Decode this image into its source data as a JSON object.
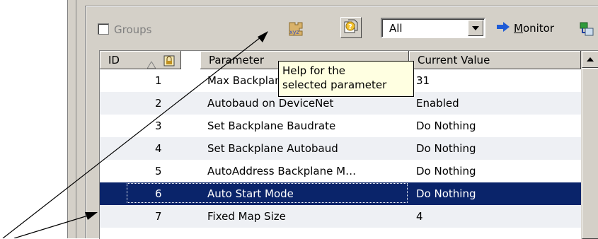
{
  "toolbar": {
    "groups_label": "Groups",
    "groups_checked": false,
    "filter_value": "All",
    "monitor_label_prefix": "",
    "monitor_label_underlined": "M",
    "monitor_label_rest": "onitor",
    "help_icon": "help-question-icon",
    "xyz_icon": "xyz-icon"
  },
  "tooltip": {
    "line1": "Help for the",
    "line2": "selected parameter"
  },
  "grid": {
    "columns": [
      "ID",
      "Parameter",
      "Current Value"
    ],
    "rows": [
      {
        "id": "1",
        "parameter": "Max Backplane Baudrate",
        "value": "31"
      },
      {
        "id": "2",
        "parameter": "Autobaud on DeviceNet",
        "value": "Enabled"
      },
      {
        "id": "3",
        "parameter": "Set Backplane Baudrate",
        "value": "Do Nothing"
      },
      {
        "id": "4",
        "parameter": "Set Backplane Autobaud",
        "value": "Do Nothing"
      },
      {
        "id": "5",
        "parameter": "AutoAddress Backplane M…",
        "value": "Do Nothing"
      },
      {
        "id": "6",
        "parameter": "Auto Start Mode",
        "value": "Do Nothing"
      },
      {
        "id": "7",
        "parameter": "Fixed Map Size",
        "value": "4"
      }
    ],
    "selected_row": "6"
  },
  "colors": {
    "selection": "#0a246a",
    "tooltip_bg": "#ffffe1",
    "window_bg": "#d4d0c8"
  }
}
